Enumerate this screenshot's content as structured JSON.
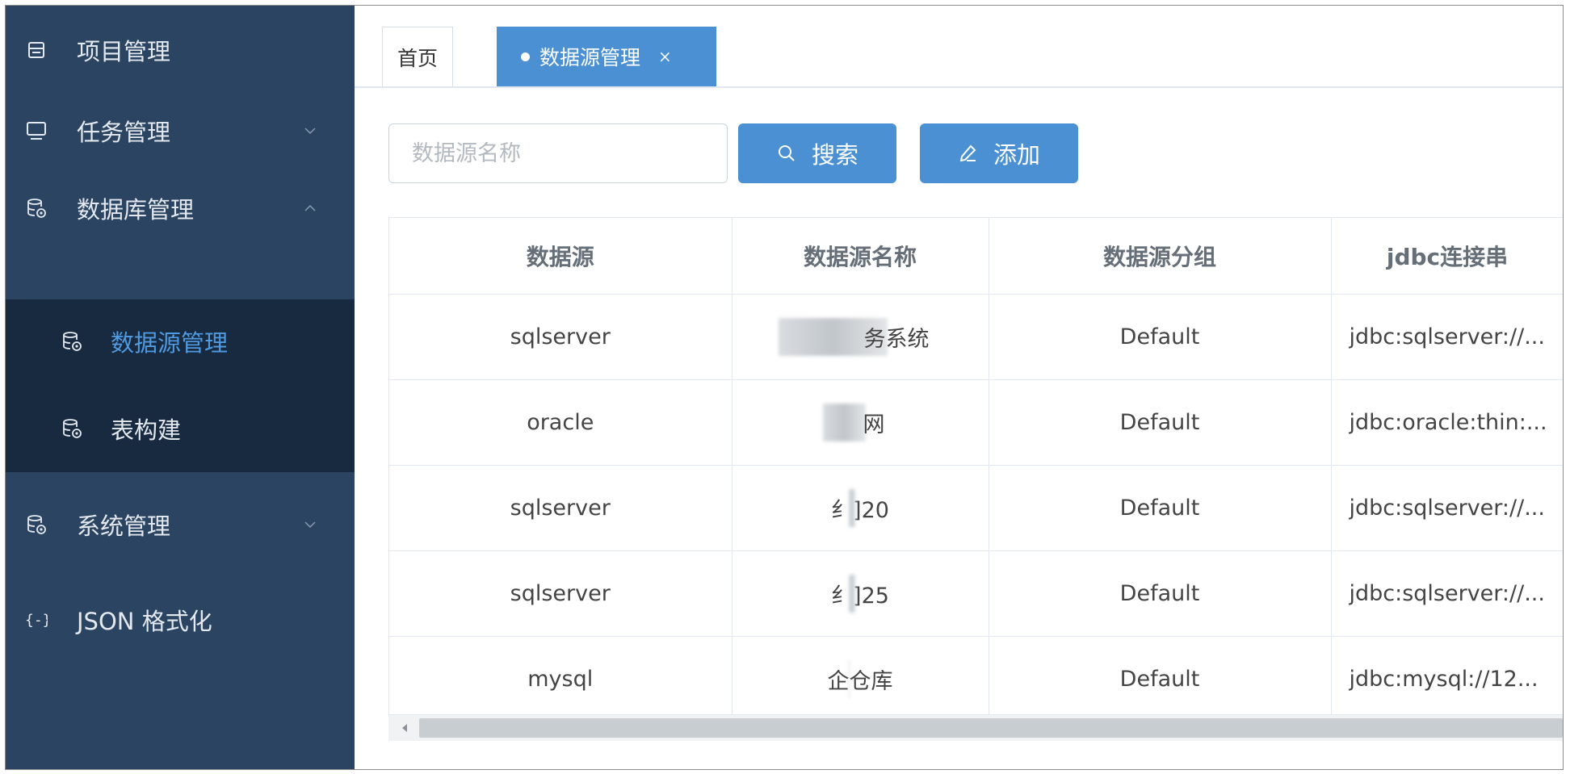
{
  "sidebar": {
    "items": [
      {
        "label": "项目管理",
        "icon": "table-icon"
      },
      {
        "label": "任务管理",
        "icon": "monitor-icon",
        "arrow": "chevron-down-icon"
      },
      {
        "label": "数据库管理",
        "icon": "database-icon",
        "arrow": "chevron-up-icon",
        "expanded": true
      },
      {
        "label": "系统管理",
        "icon": "database-icon",
        "arrow": "chevron-down-icon"
      },
      {
        "label": "JSON 格式化",
        "icon": "braces-icon"
      }
    ],
    "subitems": [
      {
        "label": "数据源管理",
        "icon": "database-icon",
        "active": true
      },
      {
        "label": "表构建",
        "icon": "database-icon"
      }
    ]
  },
  "tabs": {
    "home": "首页",
    "active": "数据源管理",
    "close": "×"
  },
  "toolbar": {
    "search_placeholder": "数据源名称",
    "search_value": "",
    "search_button": "搜索",
    "add_button": "添加"
  },
  "table": {
    "columns": [
      "数据源",
      "数据源名称",
      "数据源分组",
      "jdbc连接串"
    ],
    "rows": [
      {
        "source": "sqlserver",
        "name": "务系统",
        "group": "Default",
        "jdbc": "jdbc:sqlserver://..."
      },
      {
        "source": "oracle",
        "name": "网",
        "group": "Default",
        "jdbc": "jdbc:oracle:thin:..."
      },
      {
        "source": "sqlserver",
        "name": "纟]20",
        "group": "Default",
        "jdbc": "jdbc:sqlserver://..."
      },
      {
        "source": "sqlserver",
        "name": "纟]25",
        "group": "Default",
        "jdbc": "jdbc:sqlserver://..."
      },
      {
        "source": "mysql",
        "name": "企仓库",
        "group": "Default",
        "jdbc": "jdbc:mysql://12..."
      }
    ]
  },
  "colors": {
    "sidebar_bg": "#2a4461",
    "submenu_bg": "#182a40",
    "accent": "#4a90d2",
    "active_text": "#4f9ae0"
  }
}
